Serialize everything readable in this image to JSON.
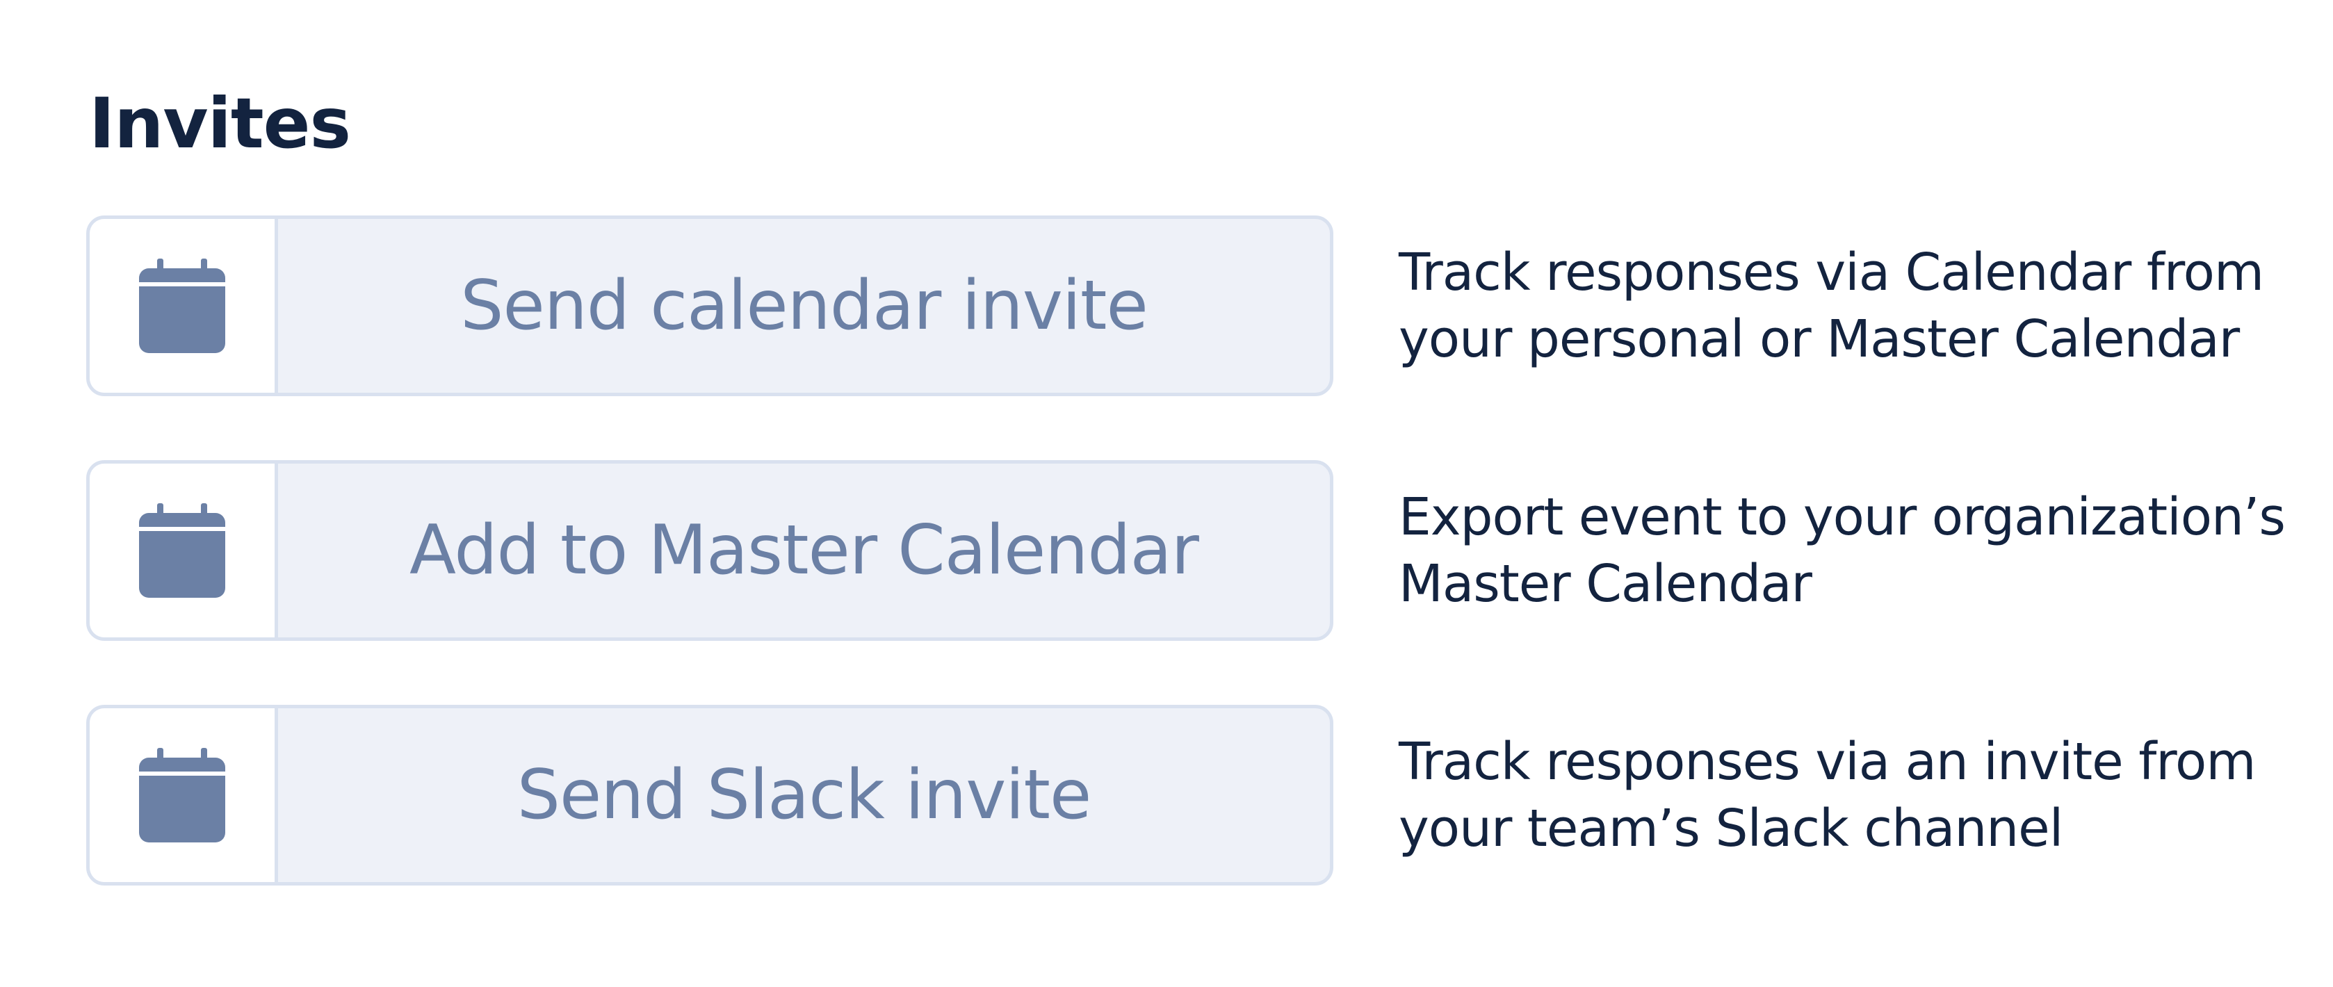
{
  "section": {
    "title": "Invites"
  },
  "icon_color": "#6b80a5",
  "invites": [
    {
      "icon": "calendar-icon",
      "button_label": "Send calendar invite",
      "description_lines": [
        "Track responses via Calendar from",
        "your personal or Master Calendar"
      ]
    },
    {
      "icon": "calendar-icon",
      "button_label": "Add to Master Calendar",
      "description_lines": [
        "Export event to your organization’s",
        "Master Calendar"
      ]
    },
    {
      "icon": "calendar-icon",
      "button_label": "Send Slack invite",
      "description_lines": [
        "Track responses via an invite from",
        "your team’s Slack channel"
      ]
    }
  ]
}
